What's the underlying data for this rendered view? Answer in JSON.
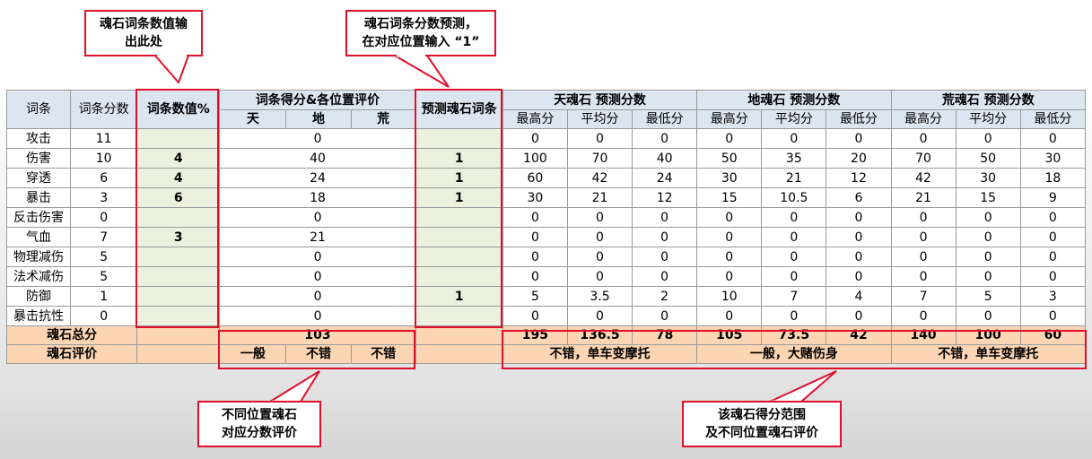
{
  "callouts": {
    "top_left": [
      "魂石词条数值输",
      "出此处"
    ],
    "top_mid": [
      "魂石词条分数预测，",
      "在对应位置输入 “1”"
    ],
    "bottom_mid": [
      "不同位置魂石",
      "对应分数评价"
    ],
    "bottom_right": [
      "该魂石得分范围",
      "及不同位置魂石评价"
    ]
  },
  "headers": {
    "attr": "词条",
    "attr_score": "词条分数",
    "attr_value": "词条数值%",
    "pos_eval": "词条得分&各位置评价",
    "pos_tian": "天",
    "pos_di": "地",
    "pos_huang": "荒",
    "predict": "预测魂石词条",
    "group_tian": "天魂石 预测分数",
    "group_di": "地魂石 预测分数",
    "group_huang": "荒魂石 预测分数",
    "max": "最高分",
    "avg": "平均分",
    "min": "最低分"
  },
  "rows": [
    {
      "name": "攻击",
      "score": "11",
      "value": "",
      "points": "0",
      "predict": "",
      "tian": [
        "0",
        "0",
        "0"
      ],
      "di": [
        "0",
        "0",
        "0"
      ],
      "huang": [
        "0",
        "0",
        "0"
      ]
    },
    {
      "name": "伤害",
      "score": "10",
      "value": "4",
      "points": "40",
      "predict": "1",
      "tian": [
        "100",
        "70",
        "40"
      ],
      "di": [
        "50",
        "35",
        "20"
      ],
      "huang": [
        "70",
        "50",
        "30"
      ]
    },
    {
      "name": "穿透",
      "score": "6",
      "value": "4",
      "points": "24",
      "predict": "1",
      "tian": [
        "60",
        "42",
        "24"
      ],
      "di": [
        "30",
        "21",
        "12"
      ],
      "huang": [
        "42",
        "30",
        "18"
      ]
    },
    {
      "name": "暴击",
      "score": "3",
      "value": "6",
      "points": "18",
      "predict": "1",
      "tian": [
        "30",
        "21",
        "12"
      ],
      "di": [
        "15",
        "10.5",
        "6"
      ],
      "huang": [
        "21",
        "15",
        "9"
      ]
    },
    {
      "name": "反击伤害",
      "score": "0",
      "value": "",
      "points": "0",
      "predict": "",
      "tian": [
        "0",
        "0",
        "0"
      ],
      "di": [
        "0",
        "0",
        "0"
      ],
      "huang": [
        "0",
        "0",
        "0"
      ]
    },
    {
      "name": "气血",
      "score": "7",
      "value": "3",
      "points": "21",
      "predict": "",
      "tian": [
        "0",
        "0",
        "0"
      ],
      "di": [
        "0",
        "0",
        "0"
      ],
      "huang": [
        "0",
        "0",
        "0"
      ]
    },
    {
      "name": "物理减伤",
      "score": "5",
      "value": "",
      "points": "0",
      "predict": "",
      "tian": [
        "0",
        "0",
        "0"
      ],
      "di": [
        "0",
        "0",
        "0"
      ],
      "huang": [
        "0",
        "0",
        "0"
      ]
    },
    {
      "name": "法术减伤",
      "score": "5",
      "value": "",
      "points": "0",
      "predict": "",
      "tian": [
        "0",
        "0",
        "0"
      ],
      "di": [
        "0",
        "0",
        "0"
      ],
      "huang": [
        "0",
        "0",
        "0"
      ]
    },
    {
      "name": "防御",
      "score": "1",
      "value": "",
      "points": "0",
      "predict": "1",
      "tian": [
        "5",
        "3.5",
        "2"
      ],
      "di": [
        "10",
        "7",
        "4"
      ],
      "huang": [
        "7",
        "5",
        "3"
      ]
    },
    {
      "name": "暴击抗性",
      "score": "0",
      "value": "",
      "points": "0",
      "predict": "",
      "tian": [
        "0",
        "0",
        "0"
      ],
      "di": [
        "0",
        "0",
        "0"
      ],
      "huang": [
        "0",
        "0",
        "0"
      ]
    }
  ],
  "total": {
    "label": "魂石总分",
    "points": "103",
    "tian": [
      "195",
      "136.5",
      "78"
    ],
    "di": [
      "105",
      "73.5",
      "42"
    ],
    "huang": [
      "140",
      "100",
      "60"
    ]
  },
  "rating": {
    "label": "魂石评价",
    "pos": [
      "一般",
      "不错",
      "不错"
    ],
    "tian": "不错，单车变摩托",
    "di": "一般，大赌伤身",
    "huang": "不错，单车变摩托"
  },
  "colors": {
    "header_blue": "#dce6f1",
    "input_green": "#ebf1de",
    "total_peach": "#fcd5b4",
    "highlight_red": "#e0102a"
  }
}
